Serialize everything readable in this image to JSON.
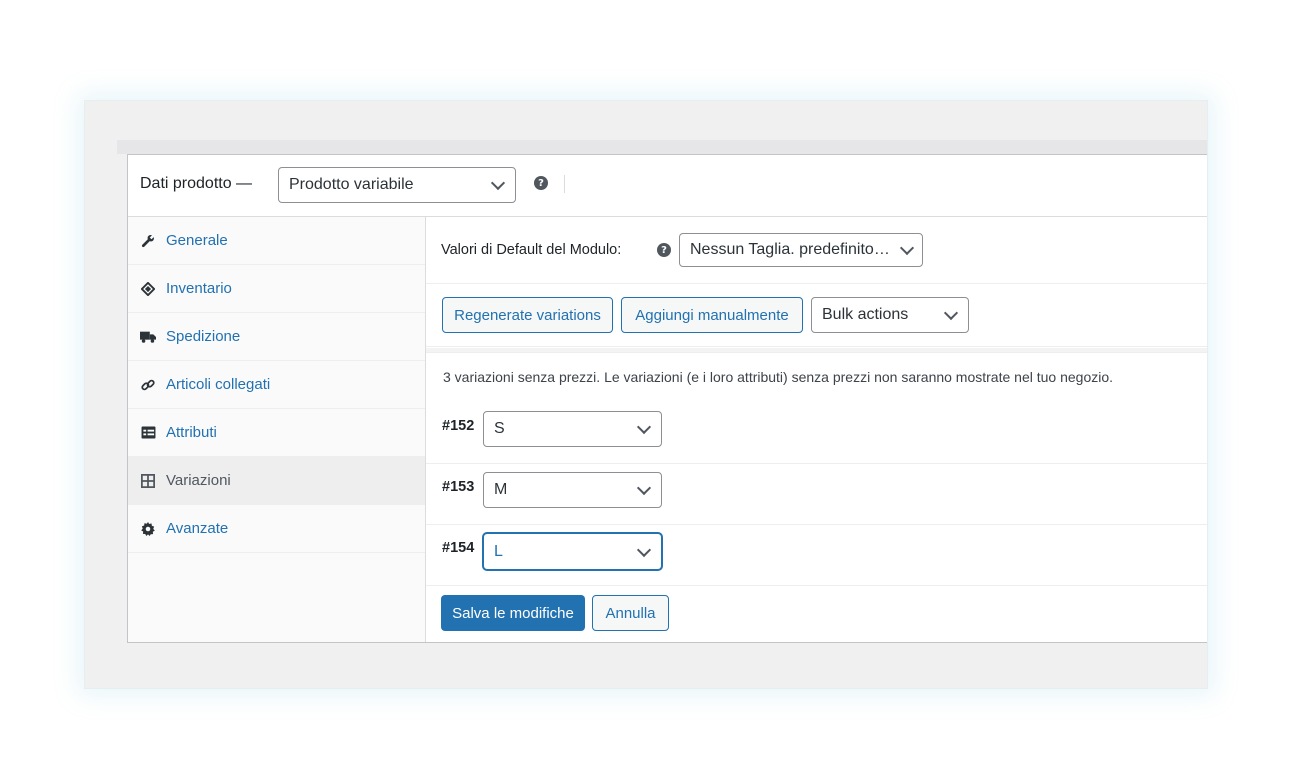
{
  "header": {
    "title": "Dati prodotto —",
    "product_type": "Prodotto variabile"
  },
  "sidebar": {
    "items": [
      {
        "label": "Generale",
        "icon": "wrench-icon"
      },
      {
        "label": "Inventario",
        "icon": "tag-icon"
      },
      {
        "label": "Spedizione",
        "icon": "truck-icon"
      },
      {
        "label": "Articoli collegati",
        "icon": "link-icon"
      },
      {
        "label": "Attributi",
        "icon": "table-icon"
      },
      {
        "label": "Variazioni",
        "icon": "grid-icon",
        "active": true
      },
      {
        "label": "Avanzate",
        "icon": "gear-icon"
      }
    ]
  },
  "defaults": {
    "label": "Valori di Default del Modulo:",
    "value": "Nessun Taglia. predefinito…"
  },
  "actions": {
    "regenerate": "Regenerate variations",
    "add_manual": "Aggiungi manualmente",
    "bulk": "Bulk actions"
  },
  "notice": "3 variazioni senza prezzi. Le variazioni (e i loro attributi) senza prezzi non saranno mostrate nel tuo negozio.",
  "variations": [
    {
      "id": "#152",
      "size": "S"
    },
    {
      "id": "#153",
      "size": "M"
    },
    {
      "id": "#154",
      "size": "L"
    }
  ],
  "footer": {
    "save": "Salva le modifiche",
    "cancel": "Annulla"
  },
  "colors": {
    "accent": "#2271b1",
    "text": "#1d2327"
  }
}
